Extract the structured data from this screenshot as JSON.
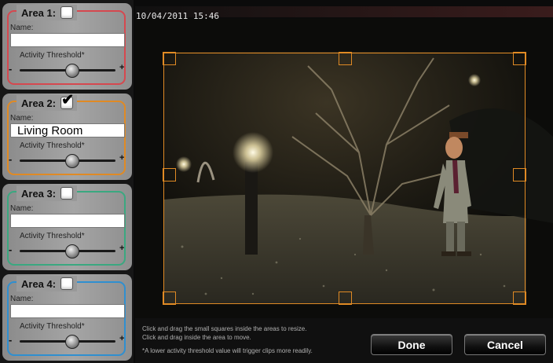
{
  "timestamp": "10/04/2011 15:46",
  "areas": [
    {
      "title": "Area 1:",
      "checked": false,
      "name_label": "Name:",
      "name_value": "",
      "threshold_label": "Activity Threshold*",
      "minus": "-",
      "plus": "+",
      "threshold_level": 0.55,
      "color": "#d6484f"
    },
    {
      "title": "Area 2:",
      "checked": true,
      "check_glyph": "✔",
      "name_label": "Name:",
      "name_value": "Living Room",
      "threshold_label": "Activity Threshold*",
      "minus": "-",
      "plus": "+",
      "threshold_level": 0.55,
      "color": "#e08a24"
    },
    {
      "title": "Area 3:",
      "checked": false,
      "name_label": "Name:",
      "name_value": "",
      "threshold_label": "Activity Threshold*",
      "minus": "-",
      "plus": "+",
      "threshold_level": 0.55,
      "color": "#3aa880"
    },
    {
      "title": "Area 4:",
      "checked": false,
      "name_label": "Name:",
      "name_value": "",
      "threshold_label": "Activity Threshold*",
      "minus": "-",
      "plus": "+",
      "threshold_level": 0.55,
      "color": "#2f8fd0"
    }
  ],
  "hints": {
    "line1": "Click and drag the small squares inside the areas to resize.",
    "line2": "Click and drag inside the area to move.",
    "line3": "*A lower activity threshold value will trigger clips more readily."
  },
  "buttons": {
    "done": "Done",
    "cancel": "Cancel"
  },
  "colors": {
    "active_region": "#e08a24"
  }
}
